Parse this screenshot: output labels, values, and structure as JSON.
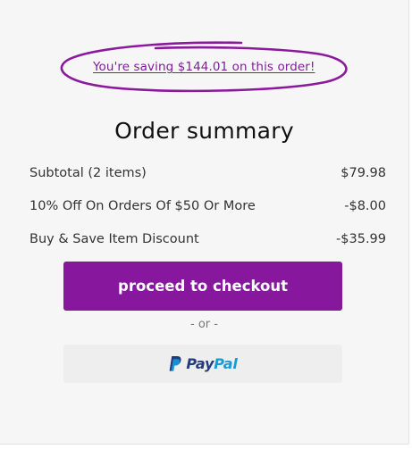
{
  "savings": {
    "text": "You're saving $144.01 on this order!",
    "highlight_color": "#8a1a9b"
  },
  "summary": {
    "title": "Order summary",
    "rows": [
      {
        "label": "Subtotal (2 items)",
        "value": "$79.98"
      },
      {
        "label": "10% Off On Orders Of $50 Or More",
        "value": "-$8.00"
      },
      {
        "label": "Buy & Save Item Discount",
        "value": "-$35.99"
      }
    ]
  },
  "checkout": {
    "label": "proceed to checkout",
    "color": "#87189d"
  },
  "separator": {
    "text": "- or -"
  },
  "paypal": {
    "pay": "Pay",
    "pal": "Pal",
    "icon": "paypal-icon"
  }
}
